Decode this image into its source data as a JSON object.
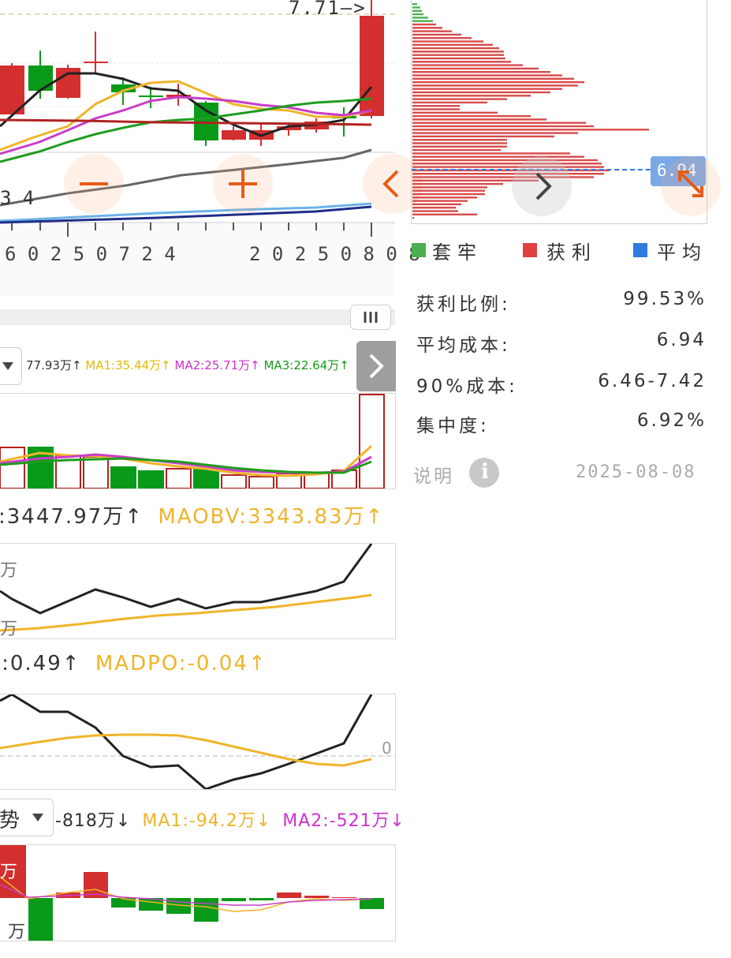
{
  "kline": {
    "price_marker": "7.71—>",
    "left_price_fragment": "3 4",
    "date_left": "6 0 2 5 0 7 2 4",
    "date_right": "2 0 2 5 0 8 0 8"
  },
  "chip": {
    "avg_label": "6.94",
    "legend": [
      {
        "label": "套牢",
        "color": "#4caf50"
      },
      {
        "label": "获利",
        "color": "#e04040"
      },
      {
        "label": "平均",
        "color": "#2f7be0"
      }
    ],
    "stats": [
      {
        "key": "获利比例:",
        "value": "99.53%"
      },
      {
        "key": "平均成本:",
        "value": "6.94"
      },
      {
        "key": "90%成本:",
        "value": "6.46-7.42"
      },
      {
        "key": "集中度:",
        "value": "6.92%"
      }
    ],
    "note_label": "说明",
    "date": "2025-08-08"
  },
  "volume": {
    "header_parts": [
      {
        "text": "77.93万↑",
        "color": "#333333"
      },
      {
        "text": "MA1:35.44万↑",
        "color": "#e6b800"
      },
      {
        "text": "MA2:25.71万↑",
        "color": "#cc33cc"
      },
      {
        "text": "MA3:22.64万↑",
        "color": "#1a9a1a"
      }
    ]
  },
  "obv": {
    "value_text": ":3447.97万↑",
    "ma_text": "MAOBV:3343.83万↑",
    "axis_top": "万",
    "axis_bottom": "万"
  },
  "dpo": {
    "value_text": "):0.49↑",
    "ma_text": "MADPO:-0.04↑",
    "zero_label": "0"
  },
  "flow": {
    "selector_label": "势",
    "value_text": "-818万↓",
    "ma1_text": "MA1:-94.2万↓",
    "ma2_text": "MA2:-521万↓",
    "axis_top": "万",
    "axis_bottom": "万"
  },
  "colors": {
    "up": "#d32f2f",
    "down": "#0a9a1a",
    "ma_yellow": "#f0b429",
    "ma_magenta": "#c93ec9",
    "ma_green": "#1f9d1f",
    "line_black": "#222222",
    "avg_blue": "#2f7be0"
  }
}
